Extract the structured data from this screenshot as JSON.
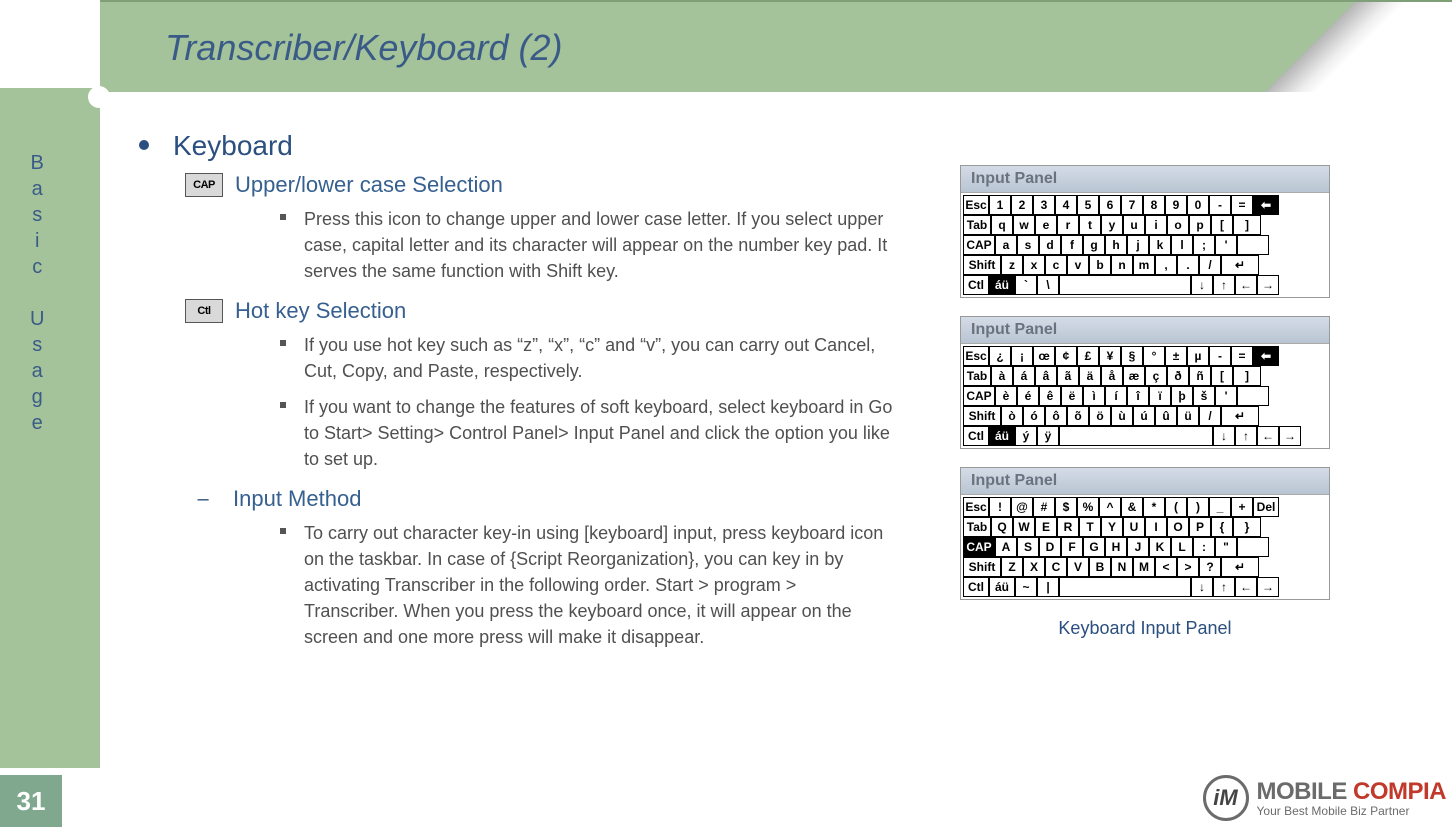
{
  "page": {
    "number": "31",
    "title": "Transcriber/Keyboard (2)",
    "sidebar_label": "B\na\ns\ni\nc\n\nU\ns\na\ng\ne"
  },
  "content": {
    "heading": "Keyboard",
    "section1": {
      "icon": "CAP",
      "title": "Upper/lower case Selection",
      "body": "Press this icon to change upper and lower case letter. If you select upper case, capital letter and its character will appear on the number key pad. It serves the same function with Shift key."
    },
    "section2": {
      "icon": "Ctl",
      "title": "Hot key Selection",
      "body1": "If you use hot key such as “z”, “x”, “c” and “v”, you can carry out Cancel, Cut, Copy, and Paste, respectively.",
      "body2": "If you want to change the features of soft keyboard, select keyboard in Go to Start> Setting> Control Panel> Input Panel and click the option you like to set up."
    },
    "section3": {
      "title": "Input Method",
      "body": "To carry out character key-in using [keyboard] input, press keyboard icon on the taskbar. In case of {Script Reorganization}, you can key in by activating Transcriber in the following order. Start > program > Transcriber. When you press the keyboard once, it will appear on the screen and one more press will make it disappear."
    }
  },
  "keyboards": {
    "panel_title": "Input Panel",
    "caption": "Keyboard Input Panel",
    "kb1": {
      "rows": [
        [
          [
            "Esc",
            26
          ],
          [
            "1",
            22
          ],
          [
            "2",
            22
          ],
          [
            "3",
            22
          ],
          [
            "4",
            22
          ],
          [
            "5",
            22
          ],
          [
            "6",
            22
          ],
          [
            "7",
            22
          ],
          [
            "8",
            22
          ],
          [
            "9",
            22
          ],
          [
            "0",
            22
          ],
          [
            "-",
            22
          ],
          [
            "=",
            22
          ],
          [
            "⬅",
            26,
            "inv"
          ]
        ],
        [
          [
            "Tab",
            28
          ],
          [
            "q",
            22
          ],
          [
            "w",
            22
          ],
          [
            "e",
            22
          ],
          [
            "r",
            22
          ],
          [
            "t",
            22
          ],
          [
            "y",
            22
          ],
          [
            "u",
            22
          ],
          [
            "i",
            22
          ],
          [
            "o",
            22
          ],
          [
            "p",
            22
          ],
          [
            "[",
            22
          ],
          [
            "]",
            28
          ]
        ],
        [
          [
            "CAP",
            32
          ],
          [
            "a",
            22
          ],
          [
            "s",
            22
          ],
          [
            "d",
            22
          ],
          [
            "f",
            22
          ],
          [
            "g",
            22
          ],
          [
            "h",
            22
          ],
          [
            "j",
            22
          ],
          [
            "k",
            22
          ],
          [
            "l",
            22
          ],
          [
            ";",
            22
          ],
          [
            "'",
            22
          ],
          [
            "",
            32
          ]
        ],
        [
          [
            "Shift",
            38
          ],
          [
            "z",
            22
          ],
          [
            "x",
            22
          ],
          [
            "c",
            22
          ],
          [
            "v",
            22
          ],
          [
            "b",
            22
          ],
          [
            "n",
            22
          ],
          [
            "m",
            22
          ],
          [
            ",",
            22
          ],
          [
            ".",
            22
          ],
          [
            "/",
            22
          ],
          [
            "↵",
            38
          ]
        ],
        [
          [
            "Ctl",
            26
          ],
          [
            "áü",
            26,
            "inv"
          ],
          [
            "`",
            22
          ],
          [
            "\\",
            22
          ],
          [
            "",
            132
          ],
          [
            "↓",
            22
          ],
          [
            "↑",
            22
          ],
          [
            "←",
            22
          ],
          [
            "→",
            22
          ]
        ]
      ]
    },
    "kb2": {
      "rows": [
        [
          [
            "Esc",
            26
          ],
          [
            "¿",
            22
          ],
          [
            "¡",
            22
          ],
          [
            "œ",
            22
          ],
          [
            "¢",
            22
          ],
          [
            "£",
            22
          ],
          [
            "¥",
            22
          ],
          [
            "§",
            22
          ],
          [
            "°",
            22
          ],
          [
            "±",
            22
          ],
          [
            "µ",
            22
          ],
          [
            "-",
            22
          ],
          [
            "=",
            22
          ],
          [
            "⬅",
            26,
            "inv"
          ]
        ],
        [
          [
            "Tab",
            28
          ],
          [
            "à",
            22
          ],
          [
            "á",
            22
          ],
          [
            "â",
            22
          ],
          [
            "ã",
            22
          ],
          [
            "ä",
            22
          ],
          [
            "å",
            22
          ],
          [
            "æ",
            22
          ],
          [
            "ç",
            22
          ],
          [
            "ð",
            22
          ],
          [
            "ñ",
            22
          ],
          [
            "[",
            22
          ],
          [
            "]",
            28
          ]
        ],
        [
          [
            "CAP",
            32
          ],
          [
            "è",
            22
          ],
          [
            "é",
            22
          ],
          [
            "ê",
            22
          ],
          [
            "ë",
            22
          ],
          [
            "ì",
            22
          ],
          [
            "í",
            22
          ],
          [
            "î",
            22
          ],
          [
            "ï",
            22
          ],
          [
            "þ",
            22
          ],
          [
            "š",
            22
          ],
          [
            "'",
            22
          ],
          [
            "",
            32
          ]
        ],
        [
          [
            "Shift",
            38
          ],
          [
            "ò",
            22
          ],
          [
            "ó",
            22
          ],
          [
            "ô",
            22
          ],
          [
            "õ",
            22
          ],
          [
            "ö",
            22
          ],
          [
            "ù",
            22
          ],
          [
            "ú",
            22
          ],
          [
            "û",
            22
          ],
          [
            "ü",
            22
          ],
          [
            "/",
            22
          ],
          [
            "↵",
            38
          ]
        ],
        [
          [
            "Ctl",
            26
          ],
          [
            "áü",
            26,
            "inv"
          ],
          [
            "ý",
            22
          ],
          [
            "ÿ",
            22
          ],
          [
            "",
            154
          ],
          [
            "↓",
            22
          ],
          [
            "↑",
            22
          ],
          [
            "←",
            22
          ],
          [
            "→",
            22
          ]
        ]
      ]
    },
    "kb3": {
      "rows": [
        [
          [
            "Esc",
            26
          ],
          [
            "!",
            22
          ],
          [
            "@",
            22
          ],
          [
            "#",
            22
          ],
          [
            "$",
            22
          ],
          [
            "%",
            22
          ],
          [
            "^",
            22
          ],
          [
            "&",
            22
          ],
          [
            "*",
            22
          ],
          [
            "(",
            22
          ],
          [
            ")",
            22
          ],
          [
            "_",
            22
          ],
          [
            "+",
            22
          ],
          [
            "Del",
            26
          ]
        ],
        [
          [
            "Tab",
            28
          ],
          [
            "Q",
            22
          ],
          [
            "W",
            22
          ],
          [
            "E",
            22
          ],
          [
            "R",
            22
          ],
          [
            "T",
            22
          ],
          [
            "Y",
            22
          ],
          [
            "U",
            22
          ],
          [
            "I",
            22
          ],
          [
            "O",
            22
          ],
          [
            "P",
            22
          ],
          [
            "{",
            22
          ],
          [
            "}",
            28
          ]
        ],
        [
          [
            "CAP",
            32,
            "inv"
          ],
          [
            "A",
            22
          ],
          [
            "S",
            22
          ],
          [
            "D",
            22
          ],
          [
            "F",
            22
          ],
          [
            "G",
            22
          ],
          [
            "H",
            22
          ],
          [
            "J",
            22
          ],
          [
            "K",
            22
          ],
          [
            "L",
            22
          ],
          [
            ":",
            22
          ],
          [
            "\"",
            22
          ],
          [
            "",
            32
          ]
        ],
        [
          [
            "Shift",
            38
          ],
          [
            "Z",
            22
          ],
          [
            "X",
            22
          ],
          [
            "C",
            22
          ],
          [
            "V",
            22
          ],
          [
            "B",
            22
          ],
          [
            "N",
            22
          ],
          [
            "M",
            22
          ],
          [
            "<",
            22
          ],
          [
            ">",
            22
          ],
          [
            "?",
            22
          ],
          [
            "↵",
            38
          ]
        ],
        [
          [
            "Ctl",
            26
          ],
          [
            "áü",
            26
          ],
          [
            "~",
            22
          ],
          [
            "|",
            22
          ],
          [
            "",
            132
          ],
          [
            "↓",
            22
          ],
          [
            "↑",
            22
          ],
          [
            "←",
            22
          ],
          [
            "→",
            22
          ]
        ]
      ]
    }
  },
  "logo": {
    "line1a": "MOBILE ",
    "line1b": "COMPIA",
    "line2": "Your Best Mobile Biz Partner",
    "badge": "iM"
  }
}
